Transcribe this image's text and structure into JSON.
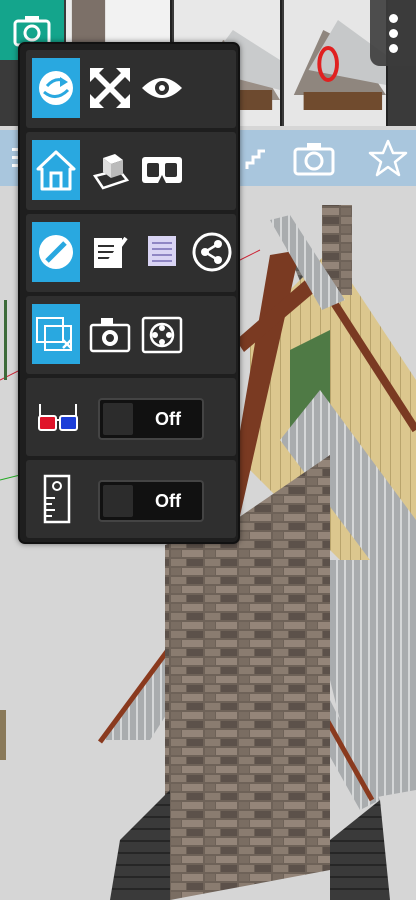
{
  "thumbnails": {
    "items": [
      "thumbnail-1",
      "thumbnail-2",
      "thumbnail-3",
      "thumbnail-4"
    ]
  },
  "toolbar": {
    "icons": [
      "menu-icon",
      "star-icon",
      "stairs-icon",
      "camera-icon",
      "star-icon"
    ]
  },
  "menu": {
    "rows": [
      {
        "name": "navigation",
        "buttons": [
          "orbit-icon",
          "zoom-extents-icon",
          "eye-icon"
        ],
        "active": "orbit-icon"
      },
      {
        "name": "views",
        "buttons": [
          "home-icon",
          "box-view-icon",
          "vr-headset-icon"
        ],
        "active": "home-icon"
      },
      {
        "name": "tools",
        "buttons": [
          "no-edit-icon",
          "notes-icon",
          "layers-icon",
          "share-icon"
        ],
        "active": "no-edit-icon"
      },
      {
        "name": "capture",
        "buttons": [
          "clear-scene-icon",
          "snapshot-icon",
          "record-icon"
        ],
        "active": "clear-scene-icon"
      }
    ],
    "anaglyph": {
      "icon": "3d-glasses-icon",
      "state": "Off"
    },
    "measure": {
      "icon": "measure-icon",
      "state": "Off"
    }
  },
  "colors": {
    "accent": "#29a8e0",
    "camera_tile": "#14a58c",
    "toolbar": "#a9c6dd",
    "menu_bg": "#1e1e1e"
  }
}
